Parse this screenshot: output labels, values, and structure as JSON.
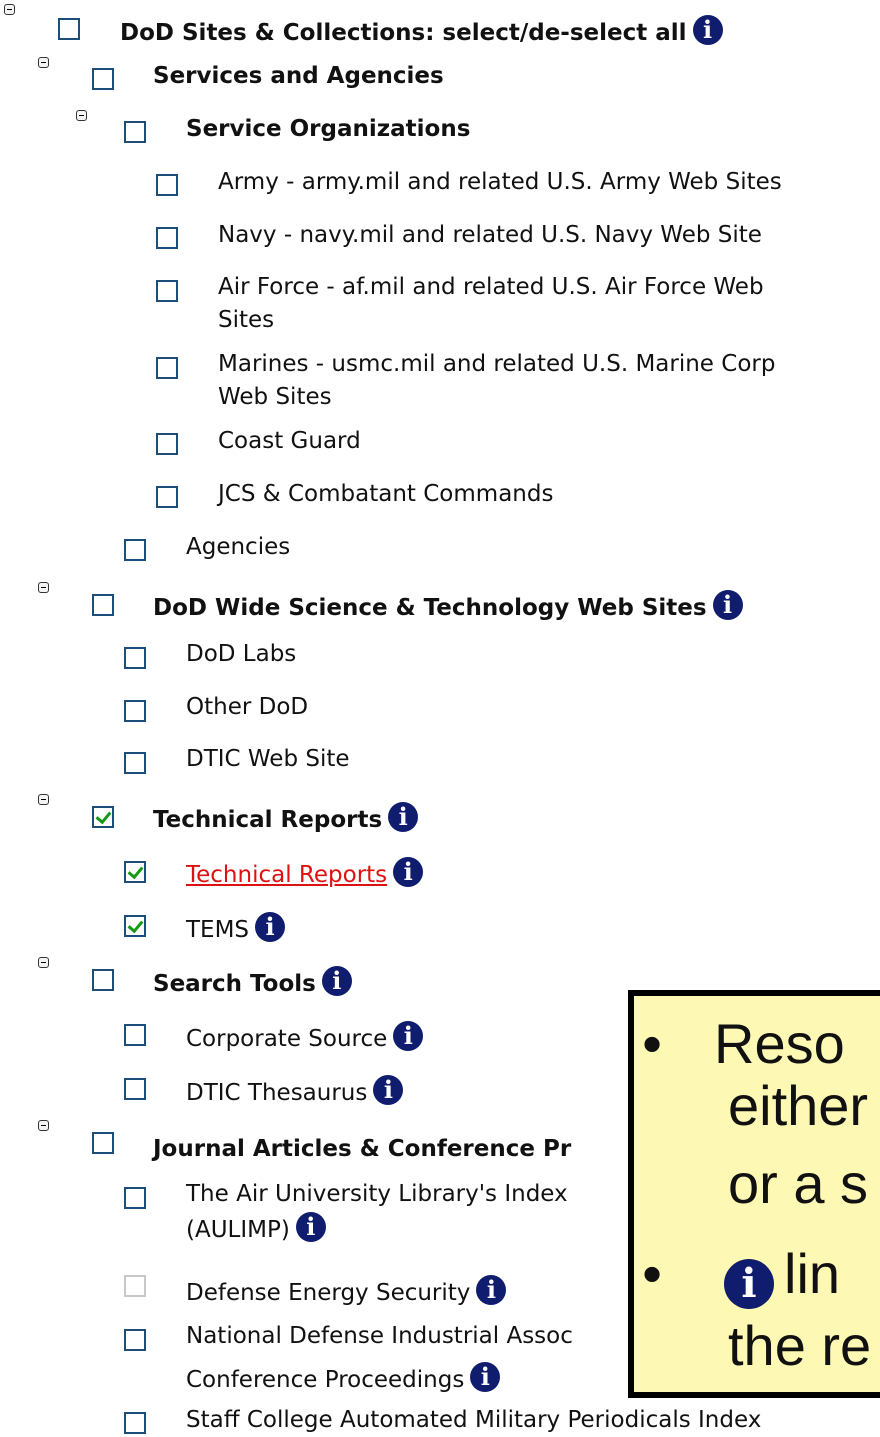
{
  "tree": {
    "root": {
      "label": "DoD Sites & Collections: select/de-select all",
      "checked": false
    },
    "services": {
      "label": "Services and Agencies",
      "checked": false
    },
    "service_orgs": {
      "label": "Service Organizations",
      "checked": false
    },
    "army": {
      "label": "Army - army.mil and related U.S. Army Web Sites",
      "checked": false
    },
    "navy": {
      "label": "Navy - navy.mil and related U.S. Navy Web Site",
      "checked": false
    },
    "airforce": {
      "label1": "Air Force - af.mil and related U.S. Air Force Web",
      "label2": "Sites",
      "checked": false
    },
    "marines": {
      "label1": "Marines - usmc.mil and related U.S. Marine Corp",
      "label2": "Web Sites",
      "checked": false
    },
    "coastguard": {
      "label": "Coast Guard",
      "checked": false
    },
    "jcs": {
      "label": "JCS & Combatant Commands",
      "checked": false
    },
    "agencies": {
      "label": "Agencies",
      "checked": false
    },
    "dodwide": {
      "label": "DoD Wide Science & Technology Web Sites",
      "checked": false
    },
    "dodlabs": {
      "label": "DoD Labs",
      "checked": false
    },
    "otherdod": {
      "label": "Other DoD",
      "checked": false
    },
    "dtic": {
      "label": "DTIC Web Site",
      "checked": false
    },
    "techreports": {
      "label": "Technical Reports",
      "checked": true
    },
    "techreports_item": {
      "label": "Technical Reports",
      "checked": true
    },
    "tems": {
      "label": "TEMS",
      "checked": true
    },
    "searchtools": {
      "label": "Search Tools",
      "checked": false
    },
    "corpsource": {
      "label": "Corporate Source",
      "checked": false
    },
    "thesaurus": {
      "label": "DTIC Thesaurus",
      "checked": false
    },
    "journal": {
      "label": "Journal Articles & Conference Pr",
      "checked": false
    },
    "aulimp": {
      "label1": "The Air University Library's Index",
      "label2": "(AULIMP)",
      "checked": false
    },
    "energy": {
      "label": "Defense Energy Security",
      "checked": false,
      "disabled": true
    },
    "ndia": {
      "label1": "National Defense Industrial Assoc",
      "label2": "Conference Proceedings",
      "checked": false
    },
    "staff": {
      "label": "Staff College Automated Military Periodicals Index",
      "checked": false
    }
  },
  "info_icon_glyph": "i",
  "callout": {
    "line1": "Reso",
    "line2": "either",
    "line3": "or a s",
    "line4": "lin",
    "line5": "the re"
  },
  "colors": {
    "link": "#dd1111",
    "info_icon": "#101d6e",
    "callout_bg": "#fdf9b4",
    "check": "#159a15"
  }
}
